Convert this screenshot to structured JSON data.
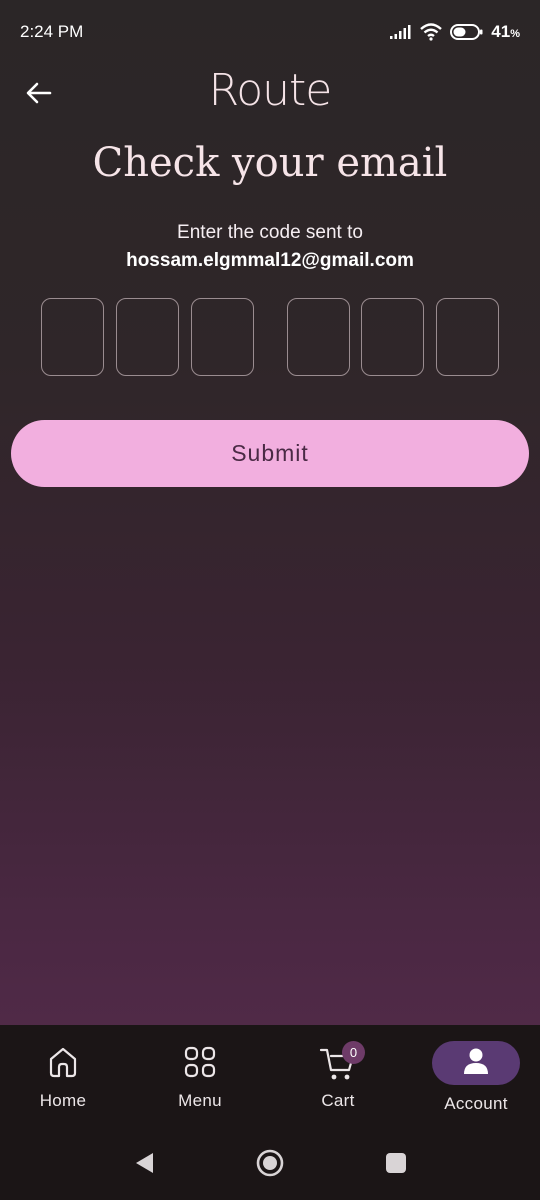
{
  "status_bar": {
    "time": "2:24 PM",
    "battery": "41",
    "battery_unit": "%",
    "icons": [
      "signal-icon",
      "wifi-icon",
      "battery-icon"
    ]
  },
  "header": {
    "logo_text": "Route",
    "back_icon": "arrow-left-icon"
  },
  "main": {
    "title": "Check your email",
    "instruction": "Enter the code sent to",
    "email": "hossam.elgmmal12@gmail.com",
    "code_digits": [
      "",
      "",
      "",
      "",
      "",
      ""
    ],
    "submit_label": "Submit"
  },
  "bottom_nav": {
    "items": [
      {
        "label": "Home",
        "icon": "home-icon"
      },
      {
        "label": "Menu",
        "icon": "grid-icon"
      },
      {
        "label": "Cart",
        "icon": "cart-icon",
        "badge": "0"
      },
      {
        "label": "Account",
        "icon": "user-icon",
        "active": true
      }
    ]
  },
  "colors": {
    "accent": "#f2afdf",
    "active_pill": "#5a3a73",
    "badge": "#6e3b68",
    "nav_background": "#1b1516"
  }
}
